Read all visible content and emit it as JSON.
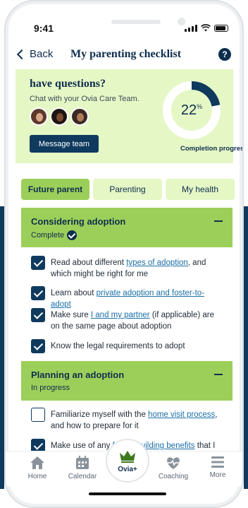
{
  "status_bar": {
    "time": "9:41"
  },
  "header": {
    "back_label": "Back",
    "title": "My parenting checklist",
    "help_glyph": "?"
  },
  "questions_card": {
    "title": "have questions?",
    "subtitle": "Chat with your Ovia Care Team.",
    "button_label": "Message team",
    "progress_value": "22",
    "progress_unit": "%",
    "progress_fraction": 0.22,
    "progress_label": "Completion progress"
  },
  "tabs": [
    {
      "label": "Future parent",
      "active": true
    },
    {
      "label": "Parenting",
      "active": false
    },
    {
      "label": "My health",
      "active": false
    }
  ],
  "sections": [
    {
      "title": "Considering adoption",
      "status": "Complete",
      "items": [
        {
          "checked": true,
          "pre": "Read about different ",
          "link": "types of adoption",
          "post": ", and which might be right for me"
        },
        {
          "checked": true,
          "pre": "Learn about ",
          "link": "private adoption and foster-to-adopt",
          "post": ""
        },
        {
          "checked": true,
          "pre": "Make sure ",
          "link": "I and my partner",
          "post": " (if applicable) are on the same page about adoption"
        },
        {
          "checked": true,
          "pre": "Know the legal requirements to adopt",
          "link": "",
          "post": ""
        }
      ]
    },
    {
      "title": "Planning an adoption",
      "status": "In progress",
      "items": [
        {
          "checked": false,
          "pre": "Familiarize myself with the ",
          "link": "home visit process",
          "post": ", and how to prepare for it"
        },
        {
          "checked": true,
          "pre": "Make use of any ",
          "link": "family-building benefits",
          "post": " that I"
        }
      ]
    }
  ],
  "bottom_nav": {
    "home": "Home",
    "calendar": "Calendar",
    "center": "Ovia+",
    "coaching": "Coaching",
    "more": "More"
  },
  "colors": {
    "navy": "#0f3a5e",
    "light_green": "#e5f7c5",
    "green": "#9ccf5a",
    "link": "#1a6fa8"
  }
}
